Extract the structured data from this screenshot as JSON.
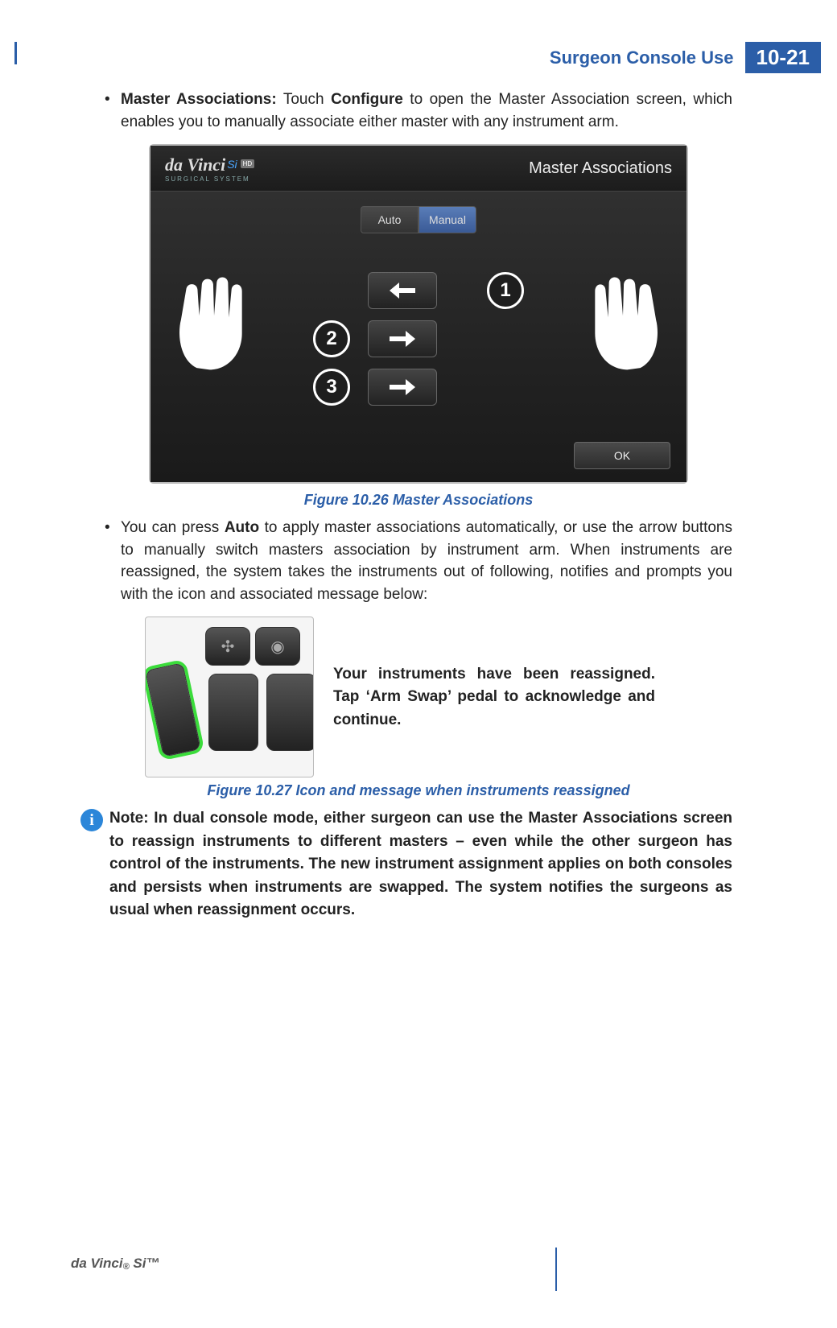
{
  "header": {
    "section_title": "Surgeon Console Use",
    "page_number": "10-21"
  },
  "bullets": {
    "b1_lead": "Master Associations:",
    "b1_mid": " Touch ",
    "b1_bold2": "Configure",
    "b1_tail": " to open the Master Association screen, which enables you to manually associate either master with any instrument arm.",
    "b2_pre": "You can press ",
    "b2_bold": "Auto",
    "b2_post": " to apply master associations automatically, or use the arrow buttons to manually switch masters association by instrument arm. When instruments are reassigned, the system takes the instruments out of following, notifies and prompts you with the icon and associated message below:"
  },
  "screenshot": {
    "brand_main": "da Vinci",
    "brand_si": "Si",
    "brand_hd": "HD",
    "brand_sub": "SURGICAL SYSTEM",
    "panel_title": "Master Associations",
    "tab_auto": "Auto",
    "tab_manual": "Manual",
    "num_left_top": "2",
    "num_left_bot": "3",
    "num_right": "1",
    "ok": "OK"
  },
  "captions": {
    "fig1": "Figure 10.26 Master Associations",
    "fig2": "Figure 10.27 Icon and message when instruments reassigned"
  },
  "fig2": {
    "pedal_plus": "✣",
    "pedal_cam": "◉",
    "message": "Your instruments have been reassigned. Tap ‘Arm Swap’ pedal to acknowledge and continue."
  },
  "note": {
    "icon": "i",
    "text": "Note: In dual console mode, either surgeon can use the Master Associations screen to reassign instruments to different masters – even while the other surgeon has control of the instruments. The new instrument assignment applies on both consoles and persists when instruments are swapped. The system notifies the surgeons as usual when reassignment occurs."
  },
  "footer": {
    "brand": "da Vinci",
    "reg": "®",
    "model": " Si™"
  }
}
